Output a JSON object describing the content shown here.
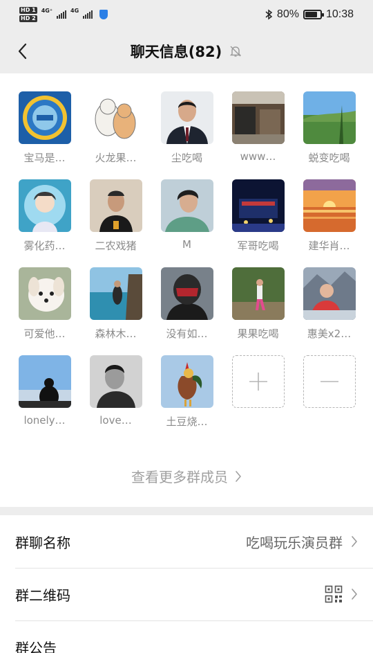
{
  "status_bar": {
    "hd1": "HD 1",
    "hd2": "HD 2",
    "net1": "4G⁺",
    "net2": "4G",
    "battery_pct": "80%",
    "battery_level": 0.8,
    "time": "10:38"
  },
  "header": {
    "title": "聊天信息(82)",
    "back_icon": "chevron-left-icon",
    "mute_icon": "bell-off-icon"
  },
  "members": [
    {
      "name": "宝马是…"
    },
    {
      "name": "火龙果…"
    },
    {
      "name": "尘吃喝"
    },
    {
      "name": "www…"
    },
    {
      "name": "蜕变吃喝"
    },
    {
      "name": "雾化药…"
    },
    {
      "name": "二农戏猪"
    },
    {
      "name": "M"
    },
    {
      "name": "军哥吃喝"
    },
    {
      "name": "建华肖…"
    },
    {
      "name": "可爱他…"
    },
    {
      "name": "森林木…"
    },
    {
      "name": "没有如…"
    },
    {
      "name": "果果吃喝"
    },
    {
      "name": "惠美x2…"
    },
    {
      "name": "lonely…"
    },
    {
      "name": "love…"
    },
    {
      "name": "土豆烧…"
    }
  ],
  "actions": {
    "add_icon": "plus-icon",
    "remove_icon": "minus-icon"
  },
  "more_members": "查看更多群成员",
  "settings": {
    "group_name_label": "群聊名称",
    "group_name_value": "吃喝玩乐演员群",
    "qr_label": "群二维码",
    "qr_icon": "qr-code-icon",
    "notice_label": "群公告"
  }
}
